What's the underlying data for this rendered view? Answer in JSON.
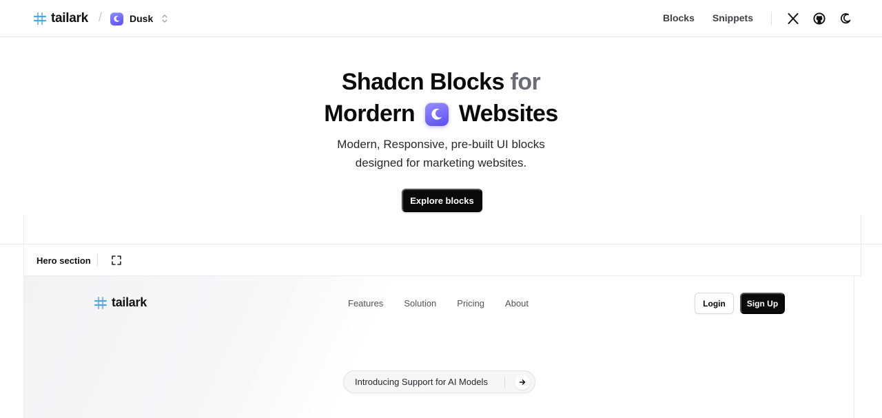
{
  "topnav": {
    "brand": "tailark",
    "theme": "Dusk",
    "links": [
      "Blocks",
      "Snippets"
    ],
    "icons": [
      "x-icon",
      "github-icon",
      "moon-icon"
    ]
  },
  "hero": {
    "title_line1_main": "Shadcn Blocks",
    "title_line1_muted": "for",
    "title_line2_before": "Mordern",
    "title_line2_after": "Websites",
    "subtitle_line1": "Modern, Responsive, pre-built UI blocks",
    "subtitle_line2": "designed for marketing websites.",
    "cta": "Explore blocks"
  },
  "block": {
    "title": "Hero section"
  },
  "preview": {
    "brand": "tailark",
    "nav": [
      "Features",
      "Solution",
      "Pricing",
      "About"
    ],
    "login": "Login",
    "signup": "Sign Up",
    "announcement": "Introducing Support for AI Models"
  },
  "colors": {
    "accent_start": "#8c8cff",
    "accent_end": "#5a4ff0",
    "primary_button": "#0a0a0a",
    "brand_mark": "#4ea8de"
  }
}
